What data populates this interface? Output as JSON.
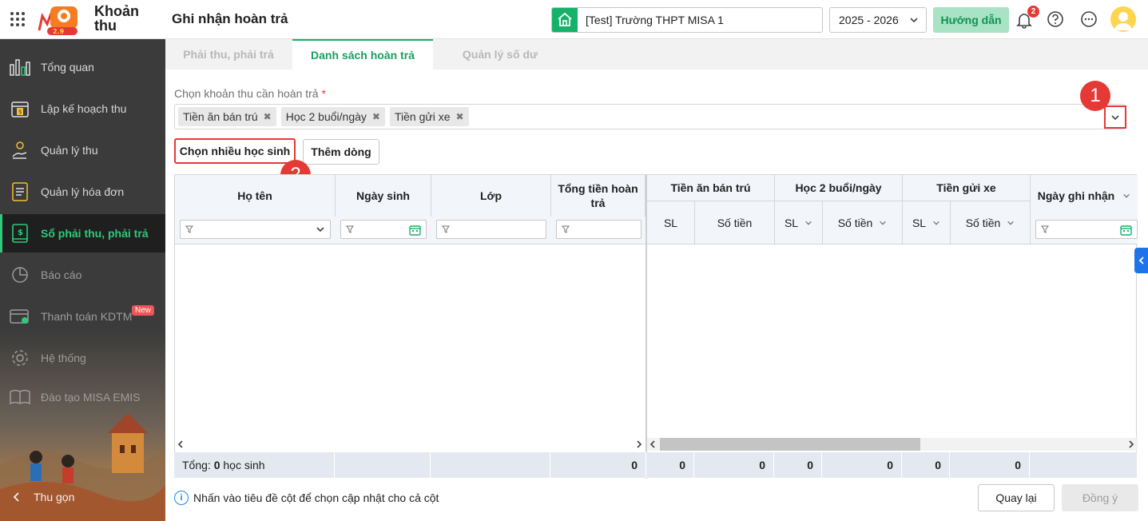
{
  "app": {
    "logo_line1": "Khoản",
    "logo_line2": "thu",
    "page_title": "Ghi nhận hoàn trả"
  },
  "header": {
    "school": "[Test] Trường THPT MISA 1",
    "year": "2025 - 2026",
    "guide_label": "Hướng dẫn",
    "notification_count": "2"
  },
  "sidebar": {
    "items": [
      {
        "label": "Tổng quan",
        "icon": "bar-chart-icon"
      },
      {
        "label": "Lập kế hoạch thu",
        "icon": "calendar-money-icon"
      },
      {
        "label": "Quản lý thu",
        "icon": "hand-coin-icon"
      },
      {
        "label": "Quản lý hóa đơn",
        "icon": "invoice-icon"
      },
      {
        "label": "Sổ phải thu, phải trả",
        "icon": "ledger-icon"
      },
      {
        "label": "Báo cáo",
        "icon": "pie-chart-icon"
      },
      {
        "label": "Thanh toán KDTM",
        "icon": "payment-card-icon"
      },
      {
        "label": "Hệ thống",
        "icon": "gear-icon"
      },
      {
        "label": "Đào tạo MISA EMIS",
        "icon": "book-open-icon"
      }
    ],
    "new_badge": "New",
    "collapse_label": "Thu gọn"
  },
  "tabs": [
    {
      "label": "Phải thu, phải trả"
    },
    {
      "label": "Danh sách hoàn trả"
    },
    {
      "label": "Quản lý số dư"
    }
  ],
  "form": {
    "fee_label": "Chọn khoản thu cần hoàn trả",
    "required_mark": "*",
    "chips": [
      "Tiền ăn bán trú",
      "Học 2 buổi/ngày",
      "Tiền gửi xe"
    ],
    "choose_students_btn": "Chọn nhiều học sinh",
    "add_row_btn": "Thêm dòng",
    "marker1": "1",
    "marker2": "2"
  },
  "grid": {
    "headers": {
      "name": "Họ tên",
      "dob": "Ngày sinh",
      "class": "Lớp",
      "total": "Tổng tiền hoàn trả",
      "fee1": "Tiền ăn bán trú",
      "fee2": "Học 2 buổi/ngày",
      "fee3": "Tiền gửi xe",
      "record_date": "Ngày ghi nhận",
      "sl": "SL",
      "amount": "Số tiền"
    },
    "footer": {
      "total_label": "Tổng:",
      "total_count": "0",
      "total_unit": "học sinh",
      "sum_total": "0",
      "f1_sl": "0",
      "f1_amount": "0",
      "f2_sl": "0",
      "f2_amount": "0",
      "f3_sl": "0",
      "f3_amount": "0"
    }
  },
  "footer": {
    "hint": "Nhấn vào tiêu đề cột để chọn cập nhật cho cả cột",
    "back_btn": "Quay lại",
    "ok_btn": "Đồng ý"
  },
  "colors": {
    "brand_green": "#17b26a",
    "sidebar_bg": "#3b3b3b",
    "highlight_red": "#e53935"
  }
}
